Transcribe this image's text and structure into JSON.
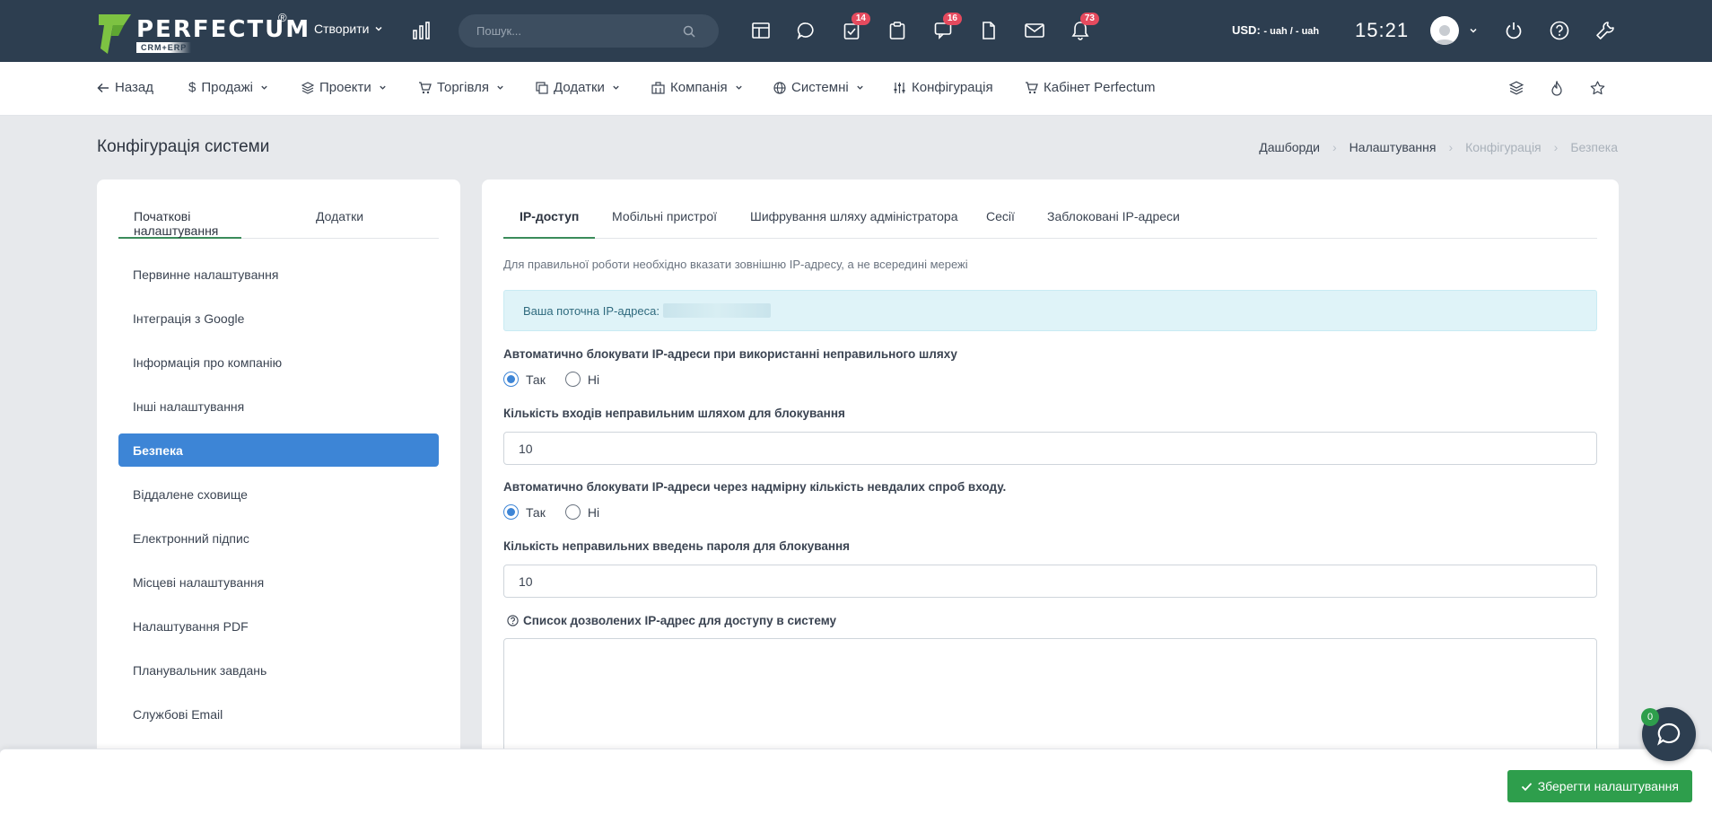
{
  "topbar": {
    "logo_text": "PERFECTUM",
    "logo_reg": "®",
    "logo_sub": "CRM+ERP",
    "create_label": "Створити",
    "search_placeholder": "Пошук...",
    "badges": {
      "tasks": "14",
      "discussions": "16",
      "notifications": "73"
    },
    "currency_label": "USD:",
    "currency_value": "- uah / - uah",
    "time": "15:21",
    "icons": [
      "bar-chart-icon",
      "search-icon",
      "layout-icon",
      "chat-icon",
      "task-check-icon",
      "clipboard-icon",
      "discussion-icon",
      "file-icon",
      "mail-icon",
      "bell-icon",
      "power-icon",
      "help-icon",
      "wrench-icon"
    ]
  },
  "subnav": {
    "back": "Назад",
    "sales": "Продажі",
    "projects": "Проекти",
    "trade": "Торгівля",
    "addons": "Додатки",
    "company": "Компанія",
    "system": "Системні",
    "config": "Конфігурація",
    "cabinet": "Кабінет Perfectum"
  },
  "page": {
    "title": "Конфігурація системи",
    "breadcrumb": [
      "Дашборди",
      "Налаштування",
      "Конфігурація",
      "Безпека"
    ]
  },
  "sidebar": {
    "tabs": [
      "Початкові налаштування",
      "Додатки"
    ],
    "items": [
      "Первинне налаштування",
      "Інтеграція з Google",
      "Інформація про компанію",
      "Інші налаштування",
      "Безпека",
      "Віддалене сховище",
      "Електронний підпис",
      "Місцеві налаштування",
      "Налаштування PDF",
      "Планувальник завдань",
      "Службові Email"
    ],
    "active_index": 4
  },
  "main": {
    "tabs": [
      "IP-доступ",
      "Мобільні пристрої",
      "Шифрування шляху адміністратора",
      "Сесії",
      "Заблоковані IP-адреси"
    ],
    "hint": "Для правильної роботи необхідно вказати зовнішню IP-адресу, а не всередині мережі",
    "alert": "Ваша поточна IP-адреса:",
    "auto_block_path": {
      "label": "Автоматично блокувати IP-адреси при використанні неправильного шляху",
      "yes": "Так",
      "no": "Ні",
      "selected": "Так"
    },
    "path_attempts": {
      "label": "Кількість входів неправильним шляхом для блокування",
      "value": "10"
    },
    "auto_block_login": {
      "label": "Автоматично блокувати IP-адреси через надмірну кількість невдалих спроб входу.",
      "yes": "Так",
      "no": "Ні",
      "selected": "Так"
    },
    "password_attempts": {
      "label": "Кількість неправильних введень пароля для блокування",
      "value": "10"
    },
    "allowed_ips": {
      "label": "Список дозволених IP-адрес для доступу в систему"
    }
  },
  "footer": {
    "save_label": "Зберегти налаштування"
  },
  "chat": {
    "badge": "0"
  }
}
